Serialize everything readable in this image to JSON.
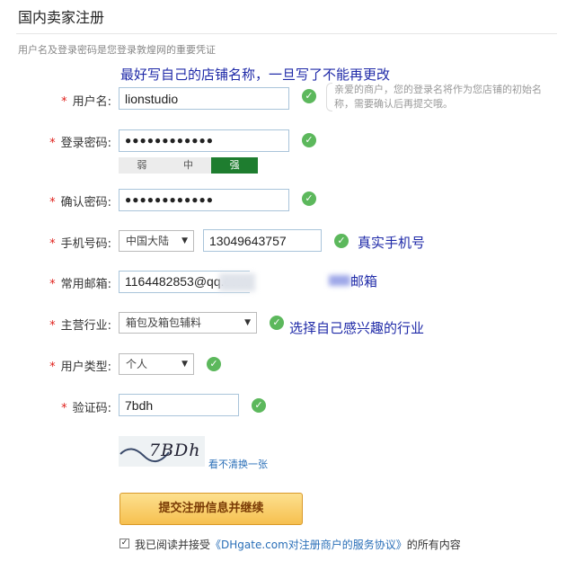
{
  "page": {
    "title": "国内卖家注册",
    "subtitle": "用户名及登录密码是您登录敦煌网的重要凭证"
  },
  "annotations": {
    "username": "最好写自己的店铺名称，一旦写了不能再更改",
    "phone": "真实手机号",
    "email": "邮箱",
    "industry": "选择自己感兴趣的行业"
  },
  "form": {
    "username": {
      "label": "用户名:",
      "value": "lionstudio",
      "hint": "亲爱的商户，您的登录名将作为您店铺的初始名称，需要确认后再提交哦。"
    },
    "password": {
      "label": "登录密码:",
      "value": "●●●●●●●●●●●●",
      "strength": [
        "弱",
        "中",
        "强"
      ],
      "strength_level": "强"
    },
    "confirm": {
      "label": "确认密码:",
      "value": "●●●●●●●●●●●●"
    },
    "phone": {
      "label": "手机号码:",
      "region": "中国大陆",
      "value": "13049643757"
    },
    "email": {
      "label": "常用邮箱:",
      "value": "1164482853@qq.com"
    },
    "industry": {
      "label": "主营行业:",
      "value": "箱包及箱包辅料"
    },
    "user_type": {
      "label": "用户类型:",
      "value": "个人"
    },
    "captcha": {
      "label": "验证码:",
      "value": "7bdh",
      "image_text": "7BDh",
      "refresh": "看不清换一张"
    }
  },
  "required_mark": "*",
  "submit_label": "提交注册信息并继续",
  "agreement": {
    "prefix": "我已阅读并接受",
    "link": "《DHgate.com对注册商户的服务协议》",
    "suffix": "的所有内容",
    "checked": true
  },
  "colors": {
    "accent_green": "#5cb85c",
    "strength_strong": "#1e7d2f",
    "annotation": "#1f2aa8",
    "required": "#e0201b",
    "button": "#f6c04f"
  },
  "icons": {
    "valid": "check-circle-icon",
    "dropdown": "chevron-down-icon",
    "checkbox": "checkbox-icon"
  }
}
